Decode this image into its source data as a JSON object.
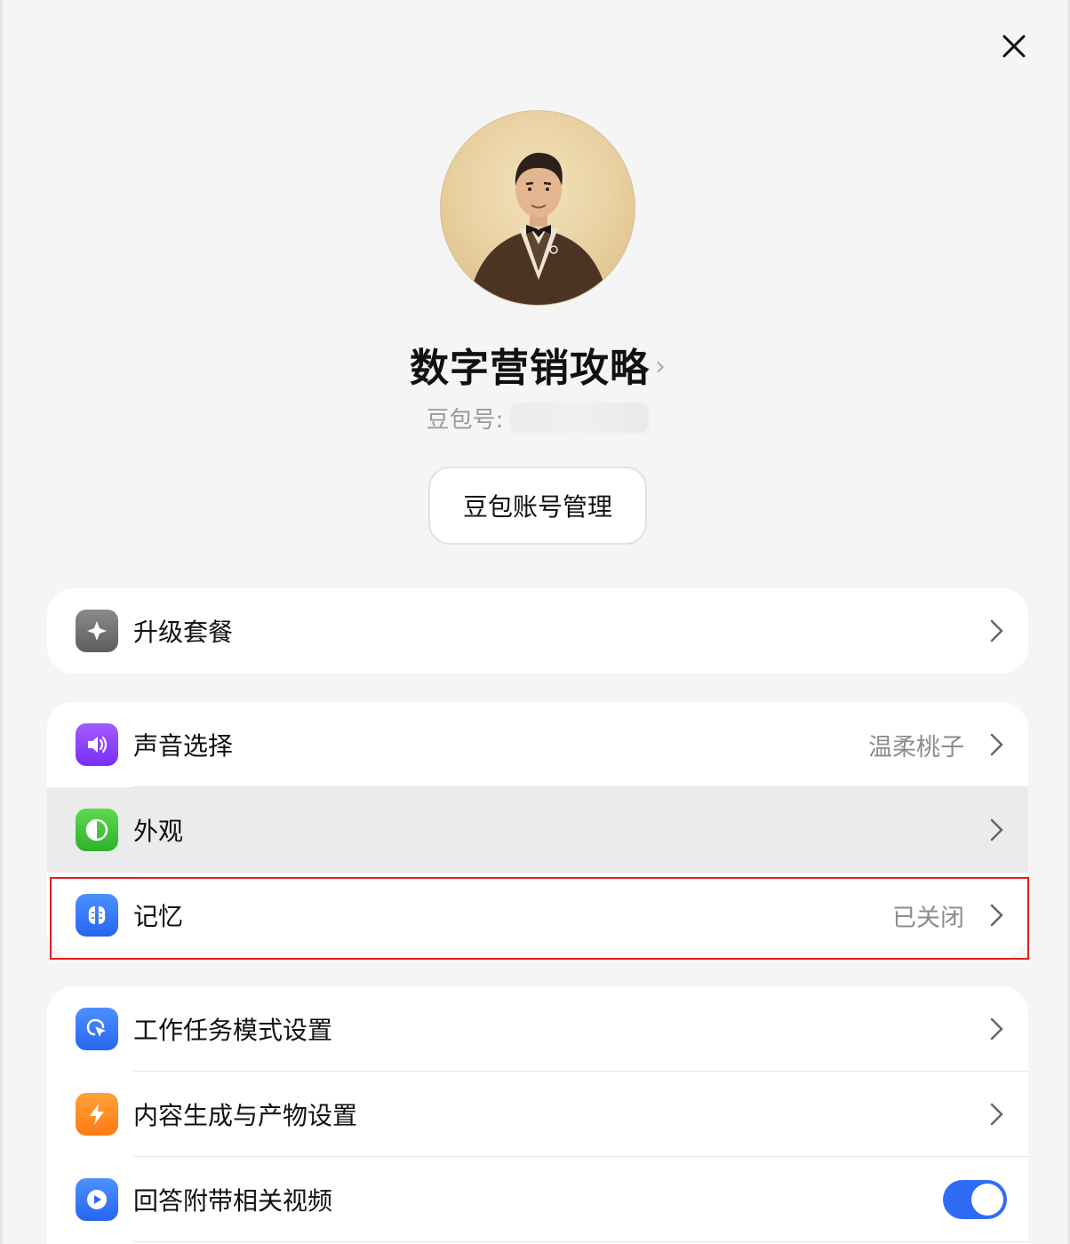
{
  "profile": {
    "name": "数字营销攻略",
    "id_label": "豆包号:",
    "account_button": "豆包账号管理"
  },
  "sections": [
    {
      "rows": [
        {
          "label": "升级套餐",
          "value": "",
          "icon": "sparkle-icon",
          "icon_color": "#6e6e6e"
        }
      ]
    },
    {
      "rows": [
        {
          "label": "声音选择",
          "value": "温柔桃子",
          "icon": "speaker-icon",
          "icon_color": "#8b3dff"
        },
        {
          "label": "外观",
          "value": "",
          "icon": "appearance-icon",
          "icon_color": "#3cc13b"
        },
        {
          "label": "记忆",
          "value": "已关闭",
          "icon": "memory-icon",
          "icon_color": "#2f7bff"
        }
      ]
    },
    {
      "rows": [
        {
          "label": "工作任务模式设置",
          "value": "",
          "icon": "cursor-click-icon",
          "icon_color": "#2f7bff"
        },
        {
          "label": "内容生成与产物设置",
          "value": "",
          "icon": "lightning-icon",
          "icon_color": "#ff8a1f"
        },
        {
          "label": "回答附带相关视频",
          "value": "",
          "icon": "play-icon",
          "icon_color": "#2f7bff",
          "toggle_on": true
        }
      ]
    }
  ]
}
